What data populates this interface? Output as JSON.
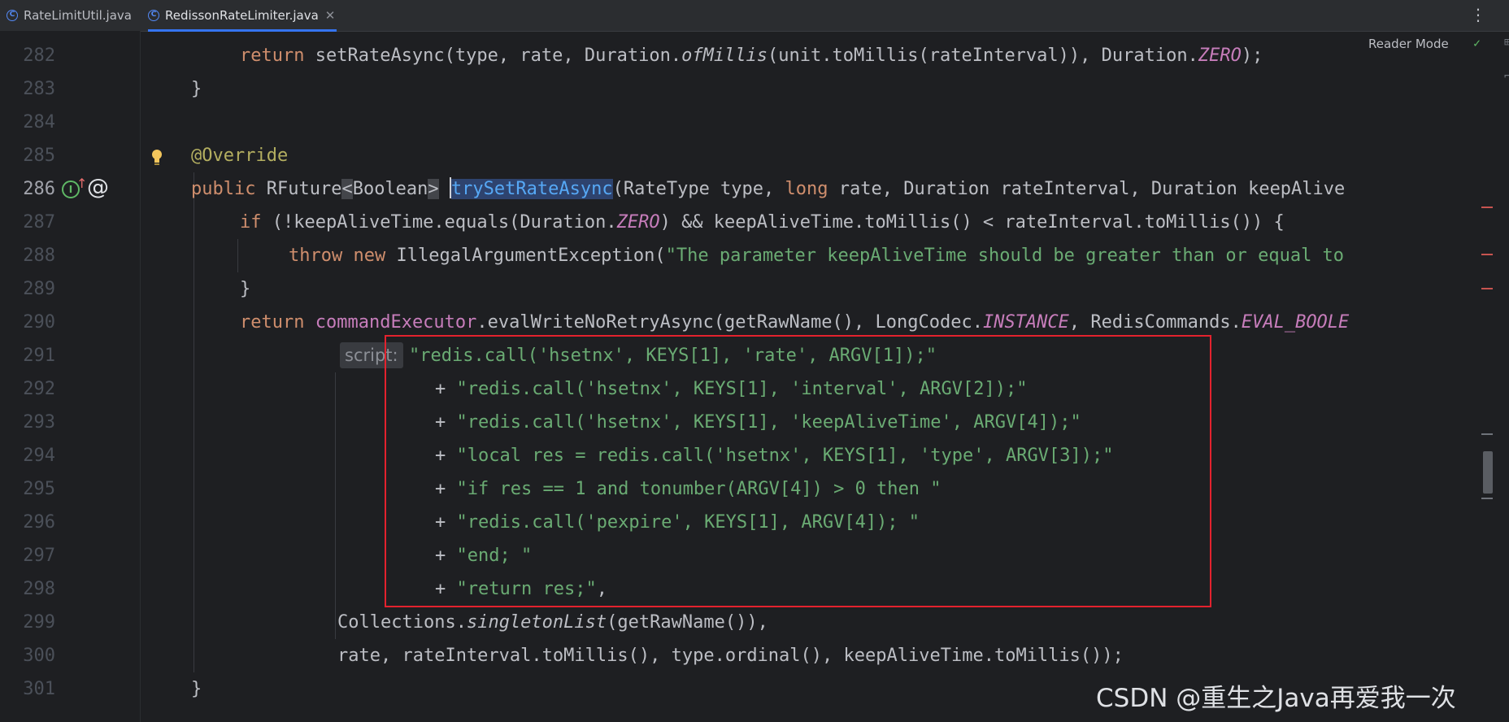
{
  "tabs": [
    {
      "label": "RateLimitUtil.java",
      "active": false
    },
    {
      "label": "RedissonRateLimiter.java",
      "active": true
    }
  ],
  "toolbar": {
    "reader_mode_label": "Reader Mode"
  },
  "gutter": {
    "line_numbers": [
      "282",
      "283",
      "284",
      "285",
      "286",
      "287",
      "288",
      "289",
      "290",
      "291",
      "292",
      "293",
      "294",
      "295",
      "296",
      "297",
      "298",
      "299",
      "300",
      "301"
    ],
    "current_line": "286"
  },
  "code": {
    "l282": {
      "kw": "return",
      "a": " setRateAsync(type, rate, Duration.",
      "m1": "ofMillis",
      "b": "(unit.toMillis(rateInterval)), Duration.",
      "c1": "ZERO",
      "end": ");"
    },
    "l283": "}",
    "l285": "@Override",
    "l286": {
      "kw": "public",
      "a": " RFuture",
      "lt": "<",
      "gen": "Boolean",
      "gt": ">",
      "sp": " ",
      "name": "trySetRateAsync",
      "b": "(RateType type, ",
      "kw2": "long",
      "c": " rate, Duration rateInterval, Duration keepAlive"
    },
    "l287": {
      "kw": "if",
      "a": " (!keepAliveTime.equals(Duration.",
      "c1": "ZERO",
      "b": ") && keepAliveTime.toMillis() < rateInterval.toMillis()) {"
    },
    "l288": {
      "kw": "throw",
      "kw2": "new",
      "a": " IllegalArgumentException(",
      "s": "\"The parameter keepAliveTime should be greater than or equal to "
    },
    "l289": "}",
    "l290": {
      "kw": "return",
      "f": "commandExecutor",
      "a": ".evalWriteNoRetryAsync(getRawName(), LongCodec.",
      "c1": "INSTANCE",
      "b": ", RedisCommands.",
      "c2": "EVAL_BOOLE"
    },
    "l291": {
      "hint": "script:",
      "s": "\"redis.call('hsetnx', KEYS[1], 'rate', ARGV[1]);\""
    },
    "l292": {
      "op": "+ ",
      "s": "\"redis.call('hsetnx', KEYS[1], 'interval', ARGV[2]);\""
    },
    "l293": {
      "op": "+ ",
      "s": "\"redis.call('hsetnx', KEYS[1], 'keepAliveTime', ARGV[4]);\""
    },
    "l294": {
      "op": "+ ",
      "s": "\"local res = redis.call('hsetnx', KEYS[1], 'type', ARGV[3]);\""
    },
    "l295": {
      "op": "+ ",
      "s": "\"if res == 1 and tonumber(ARGV[4]) > 0 then \""
    },
    "l296": {
      "op": "+ ",
      "s": "\"redis.call('pexpire', KEYS[1], ARGV[4]); \""
    },
    "l297": {
      "op": "+ ",
      "s": "\"end; \""
    },
    "l298": {
      "op": "+ ",
      "s": "\"return res;\"",
      "end": ","
    },
    "l299": {
      "a": "Collections.",
      "m1": "singletonList",
      "b": "(getRawName()),"
    },
    "l300": "rate, rateInterval.toMillis(), type.ordinal(), keepAliveTime.toMillis());",
    "l301": "}"
  },
  "watermark": "CSDN @重生之Java再爱我一次",
  "icons": {
    "file": "java-class-icon",
    "bulb": "lightbulb-icon",
    "implements": "implementing-method-icon",
    "override": "override-arrow-icon",
    "annotation": "at-sign-icon",
    "more": "more-vertical-icon",
    "check": "check-icon"
  },
  "colors": {
    "background": "#1e1f22",
    "keyword": "#cf8e6d",
    "string": "#6aab73",
    "annotation": "#b3ae60",
    "constant": "#c77dbb",
    "method_name": "#56a8f5",
    "highlight_box": "#e3222e",
    "active_tab_underline": "#3574f0"
  }
}
